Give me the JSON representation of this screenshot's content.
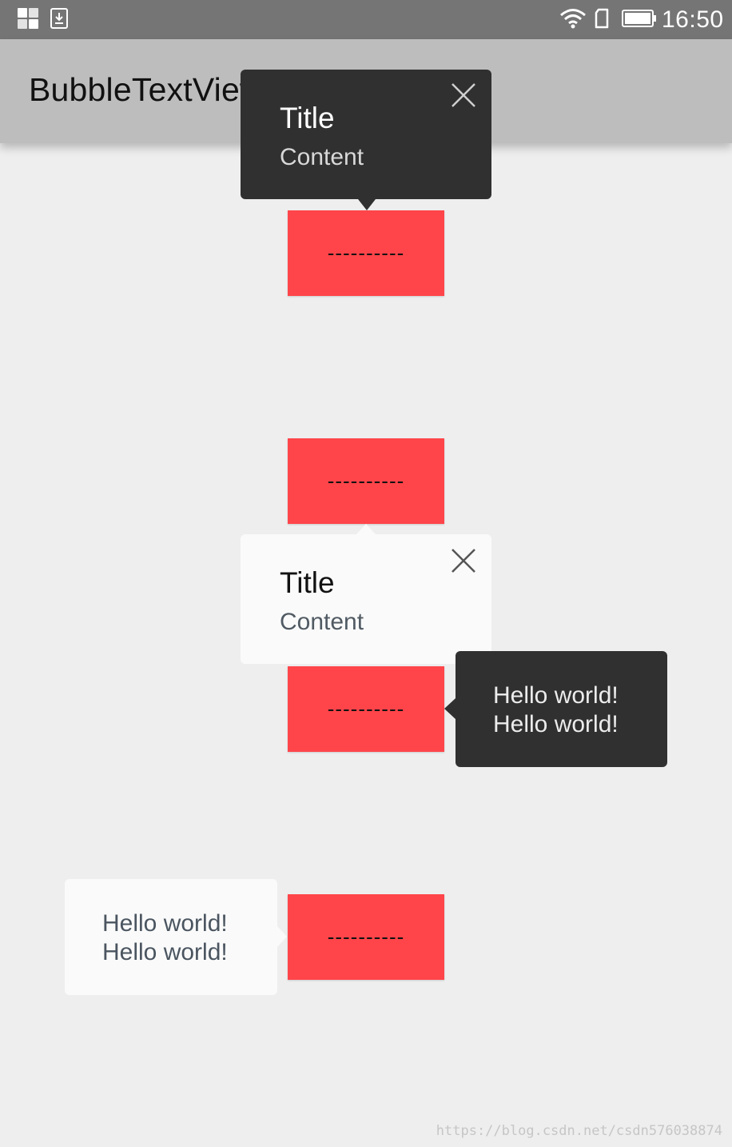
{
  "status_bar": {
    "time": "16:50",
    "icons": [
      "grid-icon",
      "download-icon",
      "wifi-icon",
      "sim-icon",
      "battery-icon"
    ]
  },
  "toolbar": {
    "title": "BubbleTextView"
  },
  "buttons": [
    {
      "label": "----------"
    },
    {
      "label": "----------"
    },
    {
      "label": "----------"
    },
    {
      "label": "----------"
    }
  ],
  "bubbles": {
    "top_dark": {
      "title": "Title",
      "content": "Content"
    },
    "middle_light": {
      "title": "Title",
      "content": "Content"
    },
    "right_dark": {
      "line1": "Hello world!",
      "line2": "Hello world!"
    },
    "left_light": {
      "line1": "Hello world!",
      "line2": "Hello world!"
    }
  },
  "colors": {
    "accent_red": "#ff454a",
    "bubble_dark": "#303030",
    "bubble_light": "#fafafa",
    "toolbar": "#bdbdbd",
    "status_bar": "#757575"
  },
  "watermark": "https://blog.csdn.net/csdn576038874"
}
